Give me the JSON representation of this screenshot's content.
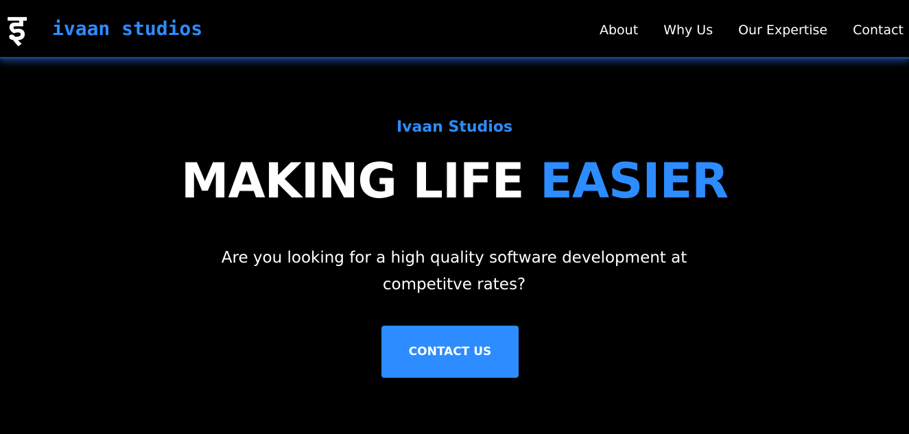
{
  "header": {
    "logo_mark": "इ",
    "brand": "ivaan studios",
    "nav": [
      {
        "label": "About"
      },
      {
        "label": "Why Us"
      },
      {
        "label": "Our Expertise"
      },
      {
        "label": "Contact"
      }
    ]
  },
  "hero": {
    "eyebrow": "Ivaan Studios",
    "headline_part1": "MAKING LIFE ",
    "headline_part2": "EASIER",
    "subtext": "Are you looking for a high quality software development at competitve rates?",
    "cta_label": "CONTACT US"
  },
  "colors": {
    "background": "#000000",
    "accent": "#2d8cff",
    "text": "#ffffff"
  }
}
